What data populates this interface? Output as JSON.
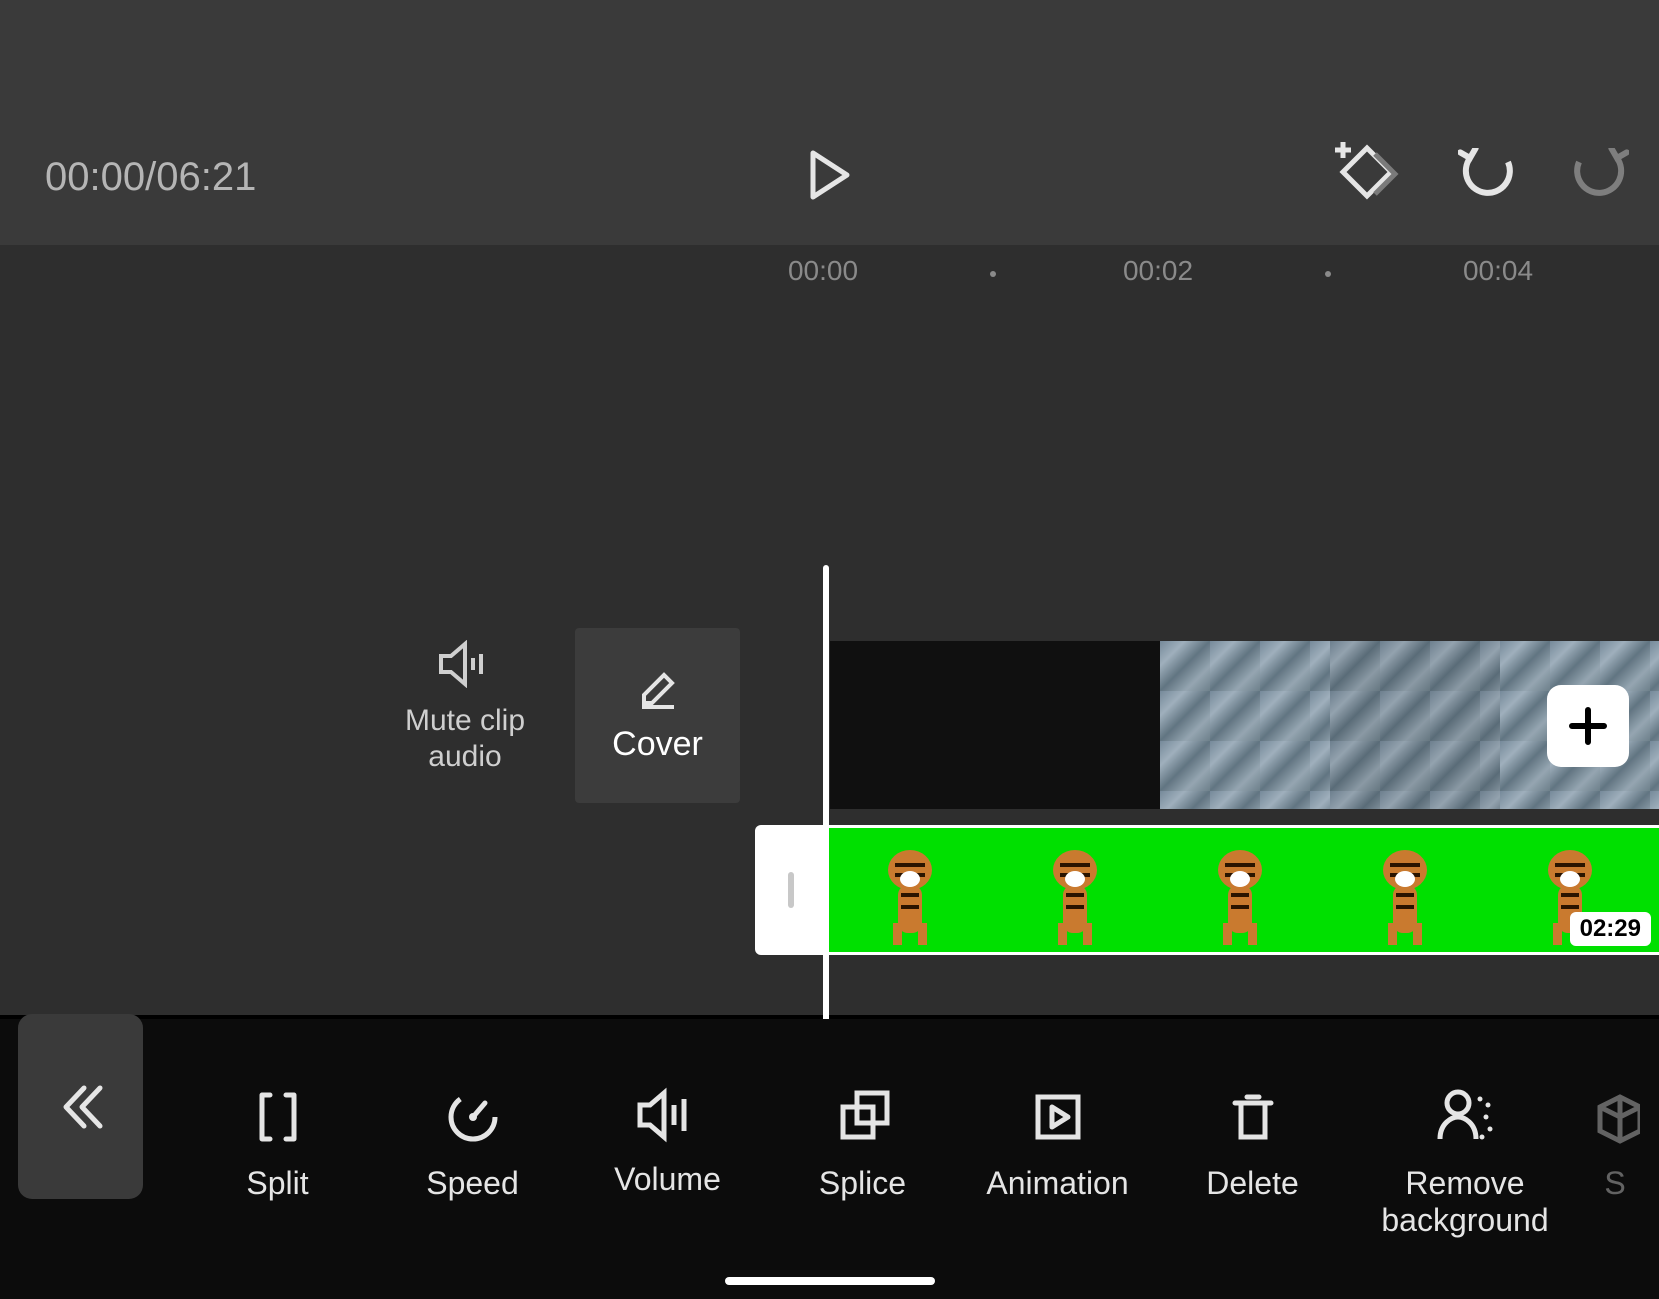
{
  "playback": {
    "current": "00:00",
    "total": "06:21",
    "combined": "00:00/06:21"
  },
  "ruler": {
    "ticks": [
      "00:00",
      "00:02",
      "00:04"
    ]
  },
  "timeline": {
    "mute_label_line1": "Mute clip",
    "mute_label_line2": "audio",
    "cover_label": "Cover",
    "overlay_duration": "02:29"
  },
  "toolbar": {
    "items": [
      {
        "id": "split",
        "label": "Split"
      },
      {
        "id": "speed",
        "label": "Speed"
      },
      {
        "id": "volume",
        "label": "Volume"
      },
      {
        "id": "splice",
        "label": "Splice"
      },
      {
        "id": "animation",
        "label": "Animation"
      },
      {
        "id": "delete",
        "label": "Delete"
      },
      {
        "id": "remove-background",
        "label": "Remove\nbackground"
      }
    ]
  }
}
